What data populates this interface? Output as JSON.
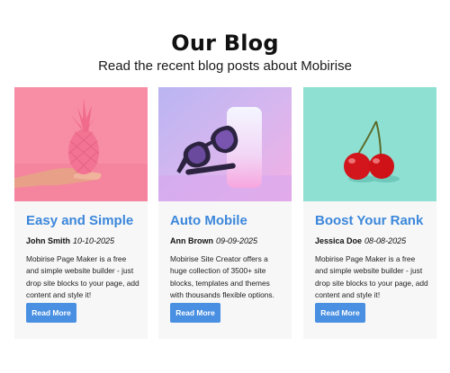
{
  "section": {
    "title": "Our Blog",
    "subtitle": "Read the recent blog posts about Mobirise"
  },
  "colors": {
    "link": "#3b87db",
    "button_bg": "#4a90e2",
    "card_bg": "#f7f7f7",
    "img1_bg": "#f78ea6",
    "img2_bg": "#c8b8f0",
    "img3_bg": "#8ee0d3"
  },
  "cards": [
    {
      "title": "Easy and Simple",
      "author": "John Smith",
      "date": "10-10-2025",
      "description": "Mobirise Page Maker is a free and simple website builder - just drop site blocks to your page, add content and style it!",
      "button": "Read More",
      "image": "pink-pineapple-on-hand"
    },
    {
      "title": "Auto Mobile",
      "author": "Ann Brown",
      "date": "09-09-2025",
      "description": "Mobirise Site Creator offers a huge collection of 3500+ site blocks, templates and themes with thousands flexible options.",
      "button": "Read More",
      "image": "sunglasses-and-phone"
    },
    {
      "title": "Boost Your Rank",
      "author": "Jessica Doe",
      "date": "08-08-2025",
      "description": "Mobirise Page Maker is a free and simple website builder - just drop site blocks to your page, add content and style it!",
      "button": "Read More",
      "image": "two-cherries"
    }
  ]
}
